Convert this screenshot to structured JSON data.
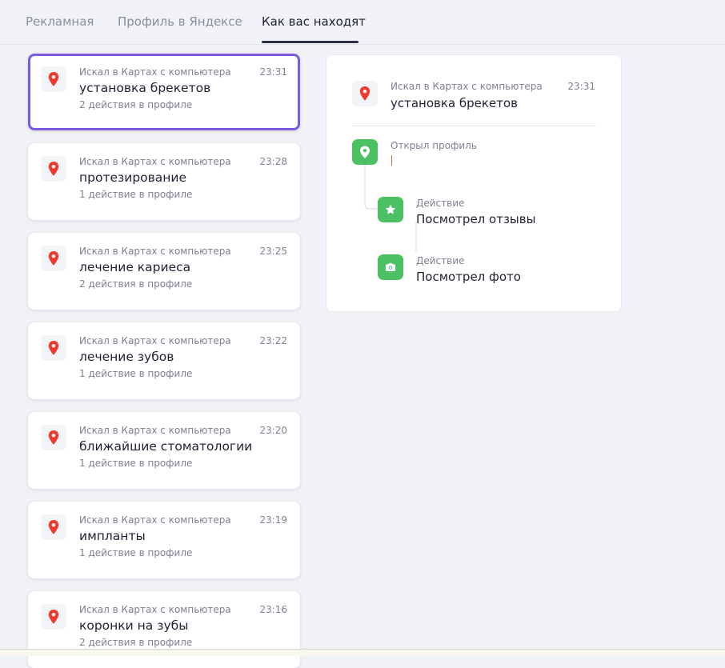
{
  "tabs": [
    {
      "label": "Рекламная"
    },
    {
      "label": "Профиль в Яндексе"
    },
    {
      "label": "Как вас находят"
    }
  ],
  "list": {
    "items": [
      {
        "source": "Искал в Картах с компьютера",
        "time": "23:31",
        "query": "установка брекетов",
        "actions": "2 действия в профиле"
      },
      {
        "source": "Искал в Картах с компьютера",
        "time": "23:28",
        "query": "протезирование",
        "actions": "1 действие в профиле"
      },
      {
        "source": "Искал в Картах с компьютера",
        "time": "23:25",
        "query": "лечение кариеса",
        "actions": "2 действия в профиле"
      },
      {
        "source": "Искал в Картах с компьютера",
        "time": "23:22",
        "query": "лечение зубов",
        "actions": "1 действие в профиле"
      },
      {
        "source": "Искал в Картах с компьютера",
        "time": "23:20",
        "query": "ближайшие стоматологии",
        "actions": "1 действие в профиле"
      },
      {
        "source": "Искал в Картах с компьютера",
        "time": "23:19",
        "query": "импланты",
        "actions": "1 действие в профиле"
      },
      {
        "source": "Искал в Картах с компьютера",
        "time": "23:16",
        "query": "коронки на зубы",
        "actions": "2 действия в профиле"
      }
    ]
  },
  "detail": {
    "source": "Искал в Картах с компьютера",
    "time": "23:31",
    "query": "установка брекетов",
    "steps": [
      {
        "label": "Открыл профиль",
        "value": "",
        "icon": "map-pin-icon"
      },
      {
        "label": "Действие",
        "value": "Посмотрел отзывы",
        "icon": "star-icon"
      },
      {
        "label": "Действие",
        "value": "Посмотрел фото",
        "icon": "camera-icon"
      }
    ]
  },
  "colors": {
    "accent": "#7b5ce0",
    "pin": "#f03a2e",
    "step_green": "#4cc063"
  }
}
